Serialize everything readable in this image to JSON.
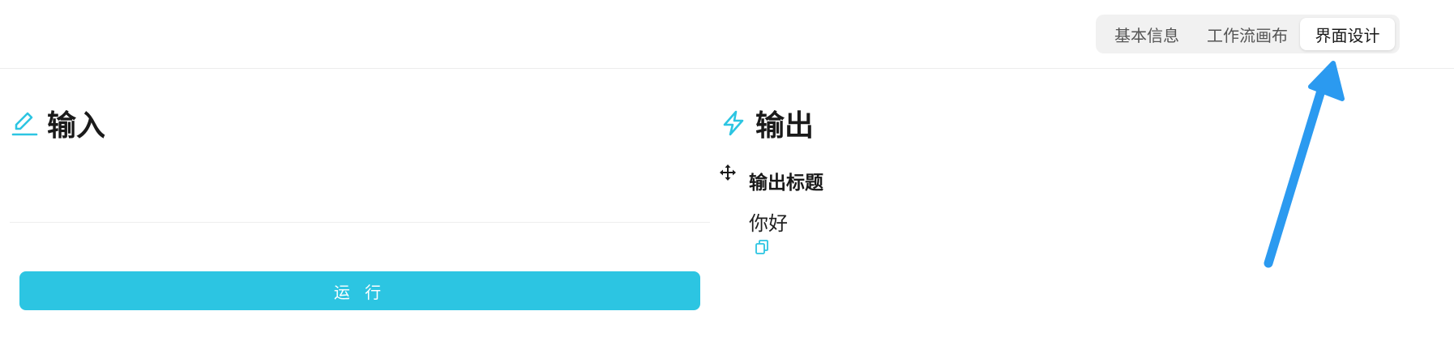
{
  "tabs": {
    "items": [
      {
        "label": "基本信息"
      },
      {
        "label": "工作流画布"
      },
      {
        "label": "界面设计"
      }
    ],
    "active_index": 2
  },
  "input_panel": {
    "title": "输入",
    "icon": "pencil-underline-icon",
    "run_button_label": "运 行"
  },
  "output_panel": {
    "title": "输出",
    "icon": "lightning-bolt-icon",
    "fields": [
      {
        "label": "输出标题",
        "value": "你好"
      }
    ]
  },
  "colors": {
    "accent": "#2cc5e2",
    "arrow": "#2b9af0",
    "segmented_bg": "#f1f1f1"
  }
}
